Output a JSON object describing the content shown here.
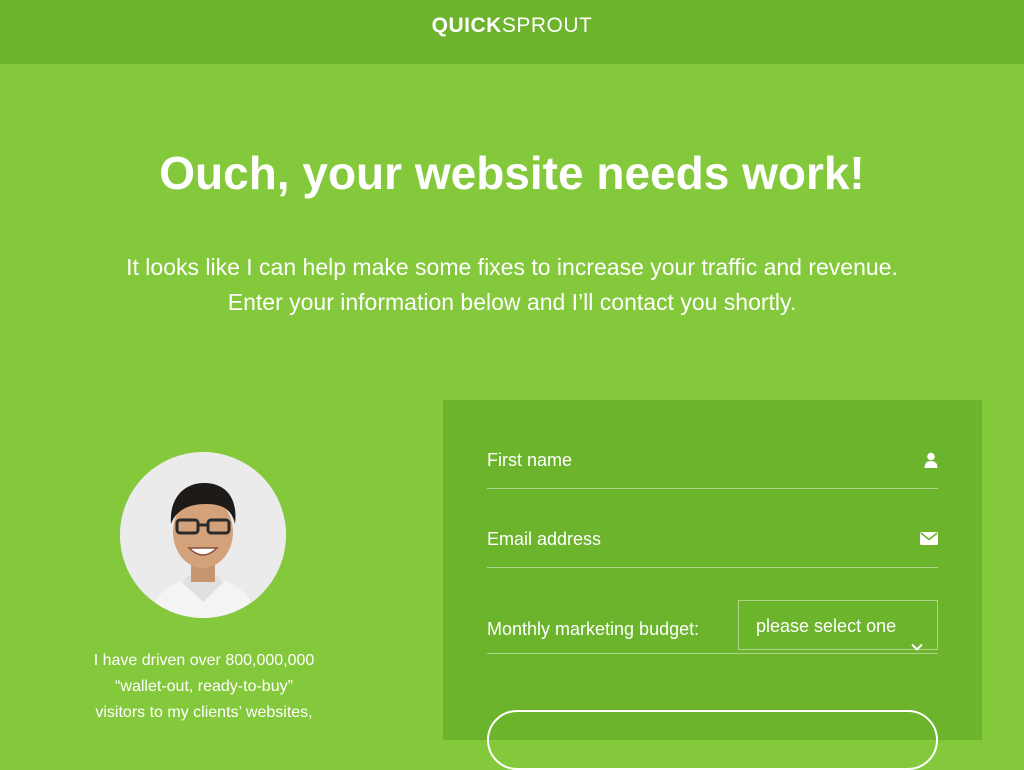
{
  "header": {
    "logo_quick": "QUICK",
    "logo_sprout": "SPROUT"
  },
  "hero": {
    "headline": "Ouch, your website needs work!",
    "sub_line1": "It looks like I can help make some fixes to increase your traffic and revenue.",
    "sub_line2": "Enter your information below and I’ll contact you shortly."
  },
  "profile": {
    "bio_line1": "I have driven over 800,000,000",
    "bio_line2": "“wallet-out, ready-to-buy”",
    "bio_line3": "visitors to my clients’ websites,"
  },
  "form": {
    "first_name_placeholder": "First name",
    "first_name_icon": "user-icon",
    "email_placeholder": "Email address",
    "email_icon": "envelope-icon",
    "budget_label": "Monthly marketing budget:",
    "budget_selected": "please select one",
    "budget_icon": "chevron-down-icon"
  },
  "colors": {
    "background": "#84c83b",
    "header_bar": "#6cb42c",
    "form_panel": "#6cb42c",
    "text": "#ffffff"
  }
}
